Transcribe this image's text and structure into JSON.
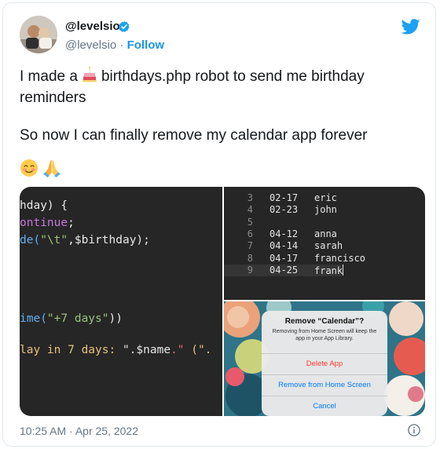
{
  "author": {
    "display_name": "@levelsio",
    "handle": "@levelsio",
    "separator": "·",
    "follow_label": "Follow"
  },
  "tweet": {
    "line1_before": "I made a",
    "line1_after": "birthdays.php robot to send me birthday",
    "line2": "reminders",
    "line3": "So now I can finally remove my calendar app forever",
    "emojis": [
      "smiling-face-icon",
      "folded-hands-icon"
    ]
  },
  "code_left": {
    "lines": [
      [
        {
          "t": "hday) {",
          "c": "#e8e8e8"
        }
      ],
      [
        {
          "t": "ontinue",
          "c": "#c678dd"
        },
        {
          "t": ";",
          "c": "#e8e8e8"
        }
      ],
      [
        {
          "t": "de(",
          "c": "#61afef"
        },
        {
          "t": "\"\\t\"",
          "c": "#98c379"
        },
        {
          "t": ",$birthday);",
          "c": "#e8e8e8"
        }
      ],
      [
        {
          "t": "ime(",
          "c": "#61afef"
        },
        {
          "t": "\"+7 days\"",
          "c": "#98c379"
        },
        {
          "t": "))",
          "c": "#e8e8e8"
        }
      ],
      [
        {
          "t": "lay in 7 days: ",
          "c": "#e5c07b"
        },
        {
          "t": "\".",
          "c": "#e8e8e8"
        },
        {
          "t": "$name",
          "c": "#e8e8e8"
        },
        {
          "t": ".\"",
          "c": "#e06c75"
        },
        {
          "t": " (\".",
          "c": "#e5c07b"
        }
      ]
    ]
  },
  "editor": {
    "rows": [
      {
        "num": "3",
        "date": "02-17",
        "name": "eric"
      },
      {
        "num": "4",
        "date": "02-23",
        "name": "john"
      },
      {
        "num": "5",
        "date": "",
        "name": ""
      },
      {
        "num": "6",
        "date": "04-12",
        "name": "anna"
      },
      {
        "num": "7",
        "date": "04-14",
        "name": "sarah"
      },
      {
        "num": "8",
        "date": "04-17",
        "name": "francisco"
      },
      {
        "num": "9",
        "date": "04-25",
        "name": "frank"
      }
    ]
  },
  "ios_dialog": {
    "title": "Remove “Calendar”?",
    "message": "Removing from Home Screen will keep the app in your App Library.",
    "delete_label": "Delete App",
    "remove_label": "Remove from Home Screen",
    "cancel_label": "Cancel"
  },
  "footer": {
    "timestamp": "10:25 AM · Apr 25, 2022"
  },
  "colors": {
    "twitter_blue": "#1da1f2",
    "link_blue": "#1b95e0",
    "delete_red": "#ff3b30",
    "ios_blue": "#007aff"
  }
}
